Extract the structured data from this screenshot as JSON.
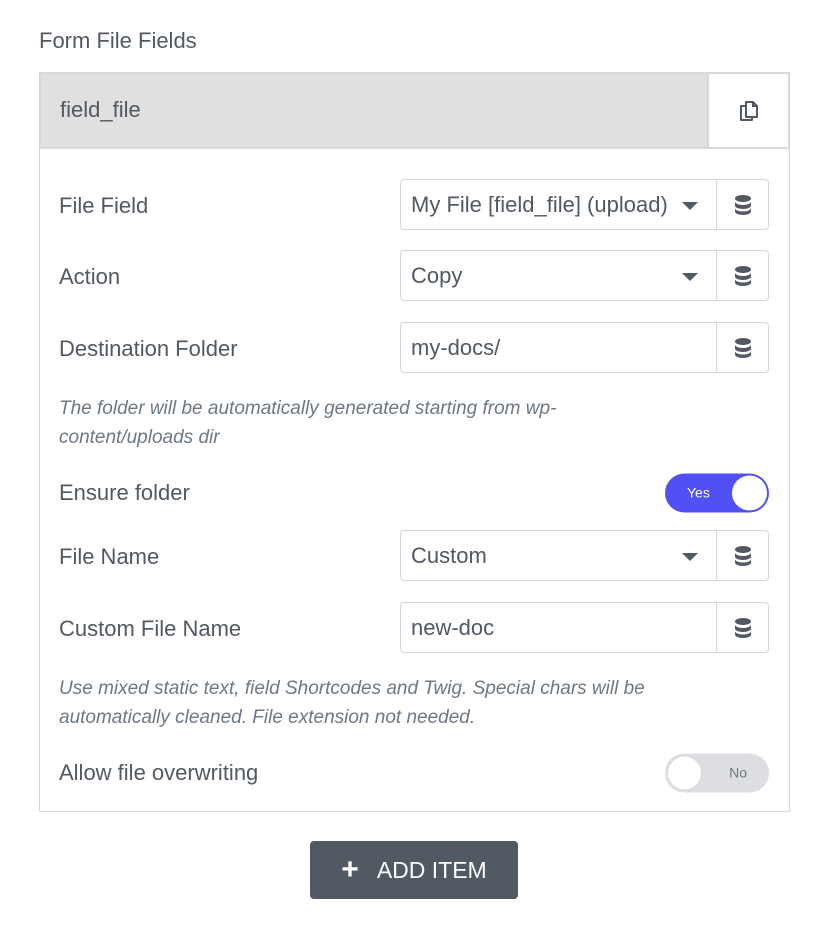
{
  "section": {
    "title": "Form File Fields"
  },
  "item": {
    "title": "field_file",
    "duplicate_icon": "copy-icon",
    "fields": [
      {
        "label": "File Field",
        "type": "select",
        "value": "My File [field_file] (upload)",
        "dynamic_icon": "database-icon"
      },
      {
        "label": "Action",
        "type": "select",
        "value": "Copy",
        "dynamic_icon": "database-icon"
      },
      {
        "label": "Destination Folder",
        "type": "text",
        "value": "my-docs/",
        "dynamic_icon": "database-icon"
      }
    ],
    "destination_help": "The folder will be automatically generated starting from wp-content/uploads dir",
    "ensure_folder": {
      "label": "Ensure folder",
      "state": "on",
      "text": "Yes",
      "accent": "#5150f5"
    },
    "file_name": {
      "label": "File Name",
      "type": "select",
      "value": "Custom",
      "dynamic_icon": "database-icon"
    },
    "custom_file_name": {
      "label": "Custom File Name",
      "type": "text",
      "value": "new-doc",
      "dynamic_icon": "database-icon"
    },
    "custom_help": "Use mixed static text, field Shortcodes and Twig. Special chars will be automatically cleaned. File extension not needed.",
    "allow_overwrite": {
      "label": "Allow file overwriting",
      "state": "off",
      "text": "No"
    }
  },
  "add_button": {
    "label": "ADD ITEM",
    "icon": "plus-icon"
  }
}
